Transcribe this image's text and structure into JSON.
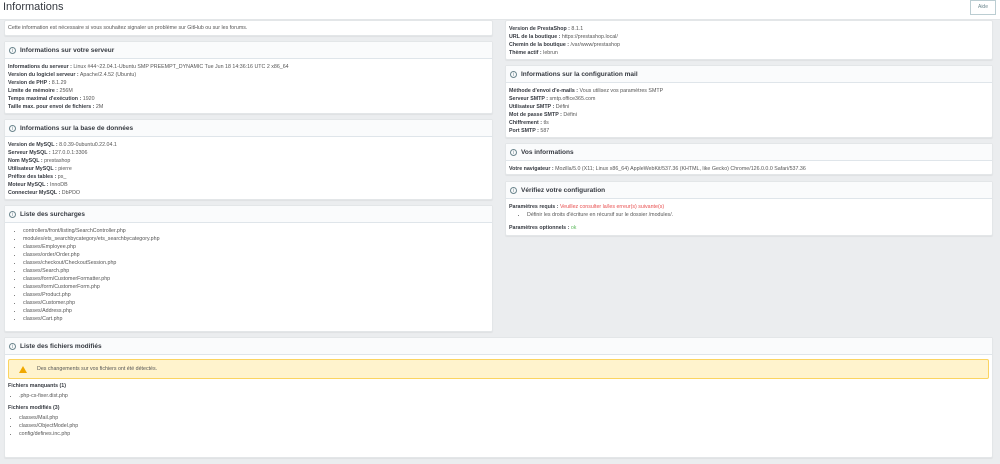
{
  "header": {
    "title": "Informations",
    "help_label": "Aide"
  },
  "intro": "Cette information est nécessaire si vous souhaitez signaler un problème sur GitHub ou sur les forums.",
  "server": {
    "title": "Informations sur votre serveur",
    "rows": [
      {
        "label": "Informations du serveur :",
        "value": " Linux #44~22.04.1-Ubuntu SMP PREEMPT_DYNAMIC Tue Jun 18 14:36:16 UTC 2 x86_64"
      },
      {
        "label": "Version du logiciel serveur :",
        "value": " Apache/2.4.52 (Ubuntu)"
      },
      {
        "label": "Version de PHP :",
        "value": " 8.1.29"
      },
      {
        "label": "Limite de mémoire :",
        "value": " 256M"
      },
      {
        "label": "Temps maximal d'exécution :",
        "value": " 1920"
      },
      {
        "label": "Taille max. pour envoi de fichiers :",
        "value": " 2M"
      }
    ]
  },
  "database": {
    "title": "Informations sur la base de données",
    "rows": [
      {
        "label": "Version de MySQL :",
        "value": " 8.0.39-0ubuntu0.22.04.1"
      },
      {
        "label": "Serveur MySQL :",
        "value": " 127.0.0.1:3306"
      },
      {
        "label": "Nom MySQL :",
        "value": " prestashop"
      },
      {
        "label": "Utilisateur MySQL :",
        "value": " pierre"
      },
      {
        "label": "Préfixe des tables :",
        "value": " ps_"
      },
      {
        "label": "Moteur MySQL :",
        "value": " InnoDB"
      },
      {
        "label": "Connecteur MySQL :",
        "value": " DbPDO"
      }
    ]
  },
  "overrides": {
    "title": "Liste des surcharges",
    "items": [
      "controllers/front/listing/SearchController.php",
      "modules/ets_searchbycategory/ets_searchbycategory.php",
      "classes/Employee.php",
      "classes/order/Order.php",
      "classes/checkout/CheckoutSession.php",
      "classes/Search.php",
      "classes/form/CustomerFormatter.php",
      "classes/form/CustomerForm.php",
      "classes/Product.php",
      "classes/Customer.php",
      "classes/Address.php",
      "classes/Cart.php"
    ]
  },
  "shop": {
    "rows": [
      {
        "label": "Version de PrestaShop :",
        "value": " 8.1.1"
      },
      {
        "label": "URL de la boutique :",
        "value": " https://prestashop.local/"
      },
      {
        "label": "Chemin de la boutique :",
        "value": " /var/www/prestashop"
      },
      {
        "label": "Thème actif :",
        "value": " lebrun"
      }
    ]
  },
  "mail": {
    "title": "Informations sur la configuration mail",
    "rows": [
      {
        "label": "Méthode d'envoi d'e-mails :",
        "value": " Vous utilisez vos paramètres SMTP"
      },
      {
        "label": "Serveur SMTP :",
        "value": " smtp.office365.com"
      },
      {
        "label": "Utilisateur SMTP :",
        "value": " Défini"
      },
      {
        "label": "Mot de passe SMTP :",
        "value": " Défini"
      },
      {
        "label": "Chiffrement :",
        "value": " tls"
      },
      {
        "label": "Port SMTP :",
        "value": " 587"
      }
    ]
  },
  "you": {
    "title": "Vos informations",
    "label": "Votre navigateur :",
    "value": " Mozilla/5.0 (X11; Linux x86_64) AppleWebKit/537.36 (KHTML, like Gecko) Chrome/126.0.0.0 Safari/537.36"
  },
  "check": {
    "title": "Vérifiez votre configuration",
    "required_label": "Paramètres requis :",
    "required_value": " Veuillez consulter la/les erreur(s) suivante(s)",
    "errors": [
      "Définir les droits d'écriture en récursif sur le dossier /modules/."
    ],
    "optional_label": "Paramètres optionnels :",
    "optional_value": " ok"
  },
  "files": {
    "title": "Liste des fichiers modifiés",
    "alert": "Des changements sur vos fichiers ont été détectés.",
    "missing_label": "Fichiers manquants (1)",
    "missing": [
      ".php-cs-fixer.dist.php"
    ],
    "modified_label": "Fichiers modifiés (3)",
    "modified": [
      "classes/Mail.php",
      "classes/ObjectModel.php",
      "config/defines.inc.php"
    ]
  },
  "colors": {
    "error": "#e84e4e",
    "ok": "#5cb85c",
    "alert_bg": "#fff3cd"
  }
}
